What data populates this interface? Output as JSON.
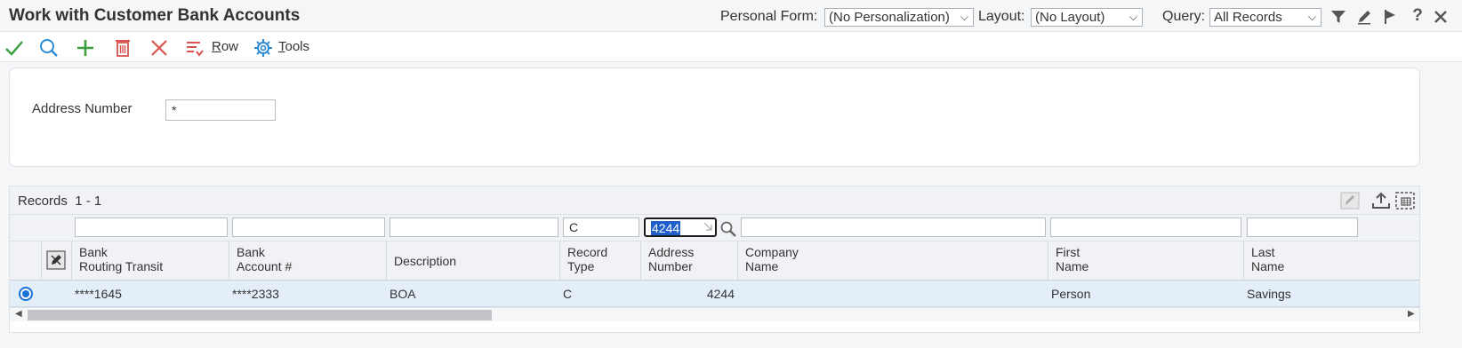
{
  "header": {
    "title": "Work with Customer Bank Accounts",
    "personal_form_label": "Personal Form:",
    "personal_form_value": "(No Personalization)",
    "layout_label": "Layout:",
    "layout_value": "(No Layout)",
    "query_label": "Query:",
    "query_value": "All Records",
    "icons": [
      "filter-icon",
      "edit-icon",
      "flag-icon",
      "help-icon",
      "close-icon"
    ],
    "help_glyph": "?"
  },
  "toolbar": {
    "icons": [
      "ok-icon",
      "find-icon",
      "add-icon",
      "delete-icon",
      "cancel-icon"
    ],
    "row_label_underlined": "R",
    "row_label_rest": "ow",
    "tools_label_underlined": "T",
    "tools_label_rest": "ools"
  },
  "criteria": {
    "address_number_label": "Address Number",
    "address_number_value": "*"
  },
  "grid": {
    "records_label": "Records",
    "records_range": "1 - 1",
    "qbe": {
      "bank_routing": "",
      "bank_account": "",
      "description": "",
      "record_type": "C",
      "address_number": "4244",
      "company_name": "",
      "first_name": "",
      "last_name": ""
    },
    "columns": [
      {
        "line1": "Bank",
        "line2": "Routing Transit"
      },
      {
        "line1": "Bank",
        "line2": "Account #"
      },
      {
        "line1": "Description",
        "line2": ""
      },
      {
        "line1": "Record",
        "line2": "Type"
      },
      {
        "line1": "Address",
        "line2": "Number"
      },
      {
        "line1": "Company",
        "line2": "Name"
      },
      {
        "line1": "First",
        "line2": "Name"
      },
      {
        "line1": "Last",
        "line2": "Name"
      }
    ],
    "rows": [
      {
        "selected": true,
        "bank_routing": "****1645",
        "bank_account": "****2333",
        "description": "BOA",
        "record_type": "C",
        "address_number": "4244",
        "company_name": "",
        "first_name": "Person",
        "last_name": "Savings"
      }
    ],
    "scroll_left_glyph": "◀",
    "scroll_right_glyph": "▶"
  }
}
